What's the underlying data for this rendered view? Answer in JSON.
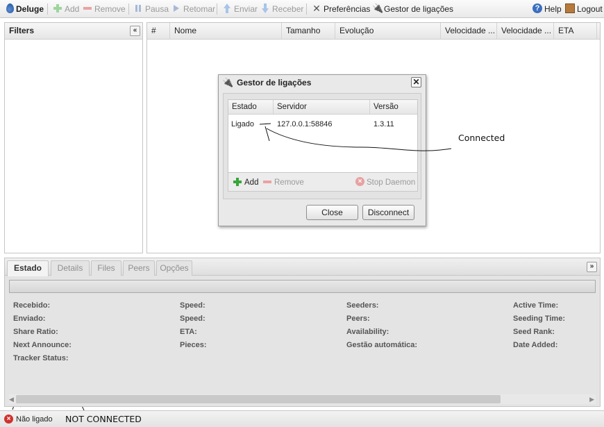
{
  "toolbar": {
    "brand": "Deluge",
    "add": "Add",
    "remove": "Remove",
    "pause": "Pausa",
    "resume": "Retomar",
    "upload": "Enviar",
    "download": "Receber",
    "preferences": "Preferências",
    "connection_manager": "Gestor de ligações",
    "help": "Help",
    "logout": "Logout"
  },
  "filters": {
    "title": "Filters"
  },
  "torrent_grid": {
    "columns": [
      "#",
      "Nome",
      "Tamanho",
      "Evolução",
      "Velocidade ...",
      "Velocidade ...",
      "ETA"
    ]
  },
  "dialog": {
    "title": "Gestor de ligações",
    "columns": [
      "Estado",
      "Servidor",
      "Versão"
    ],
    "hosts": [
      {
        "status": "Ligado",
        "server": "127.0.0.1:58846",
        "version": "1.3.11"
      }
    ],
    "add": "Add",
    "remove": "Remove",
    "stop_daemon": "Stop Daemon",
    "close": "Close",
    "disconnect": "Disconnect"
  },
  "annotations": {
    "connected": "Connected",
    "not_connected": "NOT CONNECTED"
  },
  "details": {
    "tabs": [
      "Estado",
      "Details",
      "Files",
      "Peers",
      "Opções"
    ],
    "labels": {
      "col1": [
        "Recebido:",
        "Enviado:",
        "Share Ratio:",
        "Next Announce:",
        "Tracker Status:"
      ],
      "col2": [
        "Speed:",
        "Speed:",
        "ETA:",
        "Pieces:"
      ],
      "col3": [
        "Seeders:",
        "Peers:",
        "Availability:",
        "Gestão automática:"
      ],
      "col4": [
        "Active Time:",
        "Seeding Time:",
        "Seed Rank:",
        "Date Added:"
      ]
    }
  },
  "statusbar": {
    "connection": "Não ligado"
  }
}
